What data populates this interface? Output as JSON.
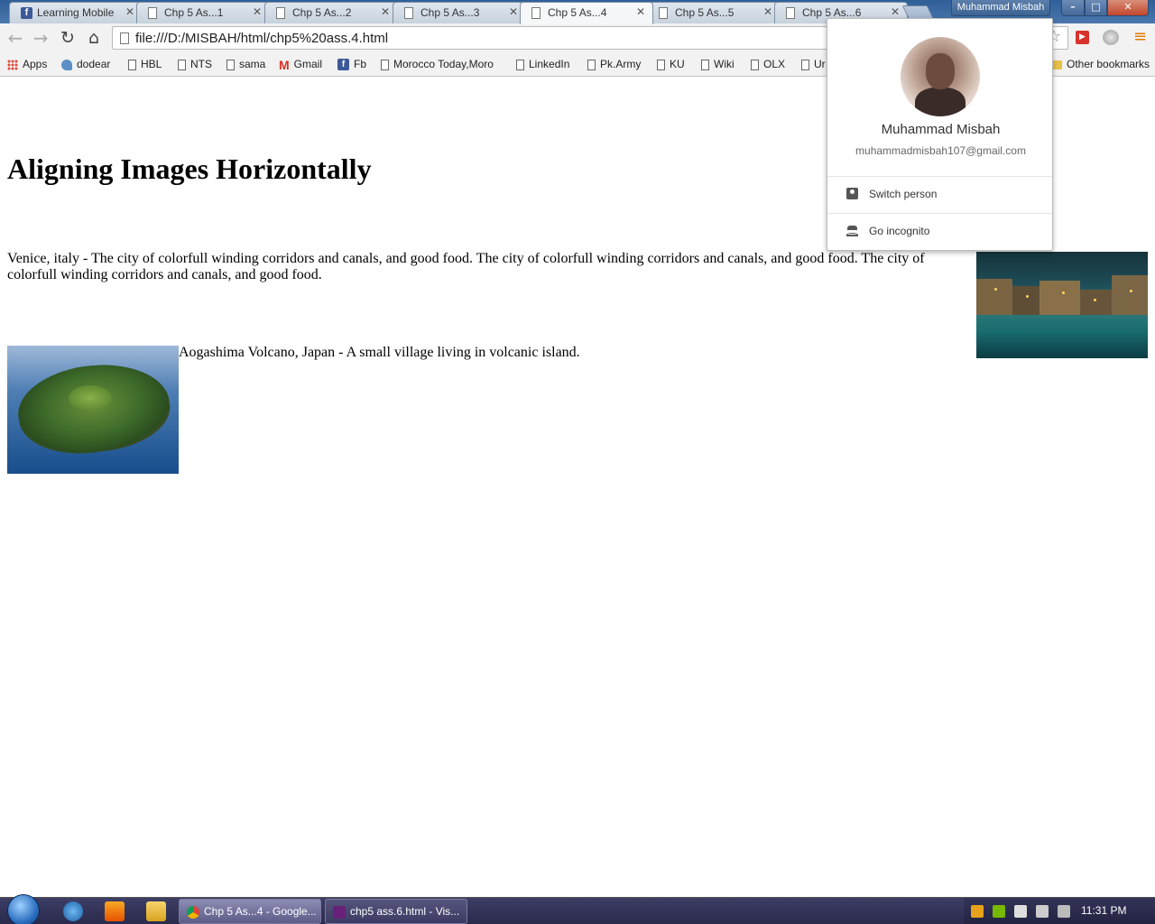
{
  "window": {
    "profile_button": "Muhammad Misbah",
    "min_label": "–",
    "max_label": "□",
    "close_label": "✕"
  },
  "tabs": [
    {
      "title": "Learning Mobile",
      "icon": "facebook-icon",
      "active": false
    },
    {
      "title": "Chp 5 As...1",
      "icon": "document-icon",
      "active": false
    },
    {
      "title": "Chp 5 As...2",
      "icon": "document-icon",
      "active": false
    },
    {
      "title": "Chp 5 As...3",
      "icon": "document-icon",
      "active": false
    },
    {
      "title": "Chp 5 As...4",
      "icon": "document-icon",
      "active": true
    },
    {
      "title": "Chp 5 As...5",
      "icon": "document-icon",
      "active": false
    },
    {
      "title": "Chp 5 As...6",
      "icon": "document-icon",
      "active": false
    }
  ],
  "toolbar": {
    "url": "file:///D:/MISBAH/html/chp5%20ass.4.html",
    "back_icon": "←",
    "forward_icon": "→",
    "reload_icon": "↻",
    "home_icon": "⌂",
    "star_icon": "☆",
    "menu_icon": "≡"
  },
  "bookmarks": [
    {
      "label": "Apps",
      "icon": "apps-icon"
    },
    {
      "label": "dodear",
      "icon": "dodear-icon"
    },
    {
      "label": "HBL",
      "icon": "document-icon"
    },
    {
      "label": "NTS",
      "icon": "document-icon"
    },
    {
      "label": "sama",
      "icon": "document-icon"
    },
    {
      "label": "Gmail",
      "icon": "gmail-icon"
    },
    {
      "label": "Fb",
      "icon": "facebook-icon"
    },
    {
      "label": "Morocco Today,Moro",
      "icon": "document-icon"
    },
    {
      "label": "LinkedIn",
      "icon": "document-icon"
    },
    {
      "label": "Pk.Army",
      "icon": "document-icon"
    },
    {
      "label": "KU",
      "icon": "document-icon"
    },
    {
      "label": "Wiki",
      "icon": "document-icon"
    },
    {
      "label": "OLX",
      "icon": "document-icon"
    },
    {
      "label": "Ur",
      "icon": "document-icon"
    }
  ],
  "other_bookmarks": "Other bookmarks",
  "page": {
    "heading": "Aligning Images Horizontally",
    "venice_text": "Venice, italy - The city of colorfull winding corridors and canals, and good food. The city of colorfull winding corridors and canals, and good food. The city of colorfull winding corridors and canals, and good food.",
    "aogashima_text": "Aogashima Volcano, Japan - A small village living in volcanic island."
  },
  "profile_popup": {
    "name": "Muhammad Misbah",
    "email": "muhammadmisbah107@gmail.com",
    "switch_person": "Switch person",
    "go_incognito": "Go incognito"
  },
  "taskbar": {
    "tasks": [
      {
        "label": "Chp 5 As...4 - Google...",
        "icon": "chrome-icon"
      },
      {
        "label": "chp5 ass.6.html - Vis...",
        "icon": "visual-studio-icon"
      }
    ],
    "clock": "11:31 PM"
  },
  "colors": {
    "tabstrip": "#3d6a9f",
    "active_tab": "#f6f7f9",
    "taskbar": "#2f2f55",
    "popup_bg": "#ffffff"
  }
}
